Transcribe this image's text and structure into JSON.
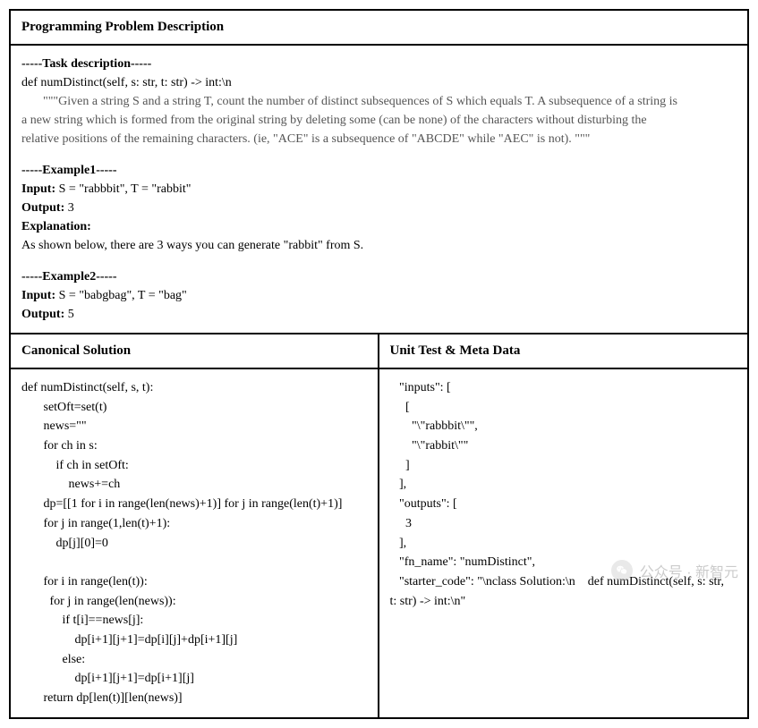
{
  "header": {
    "title": "Programming Problem Description"
  },
  "task": {
    "header": "-----Task description-----",
    "signature": "def numDistinct(self, s: str, t: str) -> int:\\n",
    "docstring": "\"\"\"Given a string S and a string T, count the number of distinct subsequences of S which equals T. A subsequence of a string is",
    "docstring2": "a new string which is formed from the original string by deleting some (can be none) of the characters without disturbing the",
    "docstring3": "relative positions of the remaining characters. (ie, \"ACE\" is a subsequence of \"ABCDE\" while \"AEC\" is not). \"\"\""
  },
  "example1": {
    "header": "-----Example1-----",
    "input_label": "Input:",
    "input_value": " S = \"rabbbit\", T = \"rabbit\"",
    "output_label": "Output:",
    "output_value": " 3",
    "explanation_label": "Explanation:",
    "explanation_text": "As shown below, there are 3 ways you can generate \"rabbit\" from S."
  },
  "example2": {
    "header": "-----Example2-----",
    "input_label": "Input:",
    "input_value": " S = \"babgbag\", T = \"bag\"",
    "output_label": "Output:",
    "output_value": " 5"
  },
  "columns": {
    "left_title": "Canonical Solution",
    "right_title": "Unit Test & Meta Data"
  },
  "solution": {
    "line1": "def numDistinct(self, s, t):",
    "line2": "       setOft=set(t)",
    "line3": "       news=\"\"",
    "line4": "       for ch in s:",
    "line5": "           if ch in setOft:",
    "line6": "               news+=ch",
    "line7": "       dp=[[1 for i in range(len(news)+1)] for j in range(len(t)+1)]",
    "line8": "       for j in range(1,len(t)+1):",
    "line9": "           dp[j][0]=0",
    "line10": "",
    "line11": "       for i in range(len(t)):",
    "line12": "         for j in range(len(news)):",
    "line13": "             if t[i]==news[j]:",
    "line14": "                 dp[i+1][j+1]=dp[i][j]+dp[i+1][j]",
    "line15": "             else:",
    "line16": "                 dp[i+1][j+1]=dp[i+1][j]",
    "line17": "       return dp[len(t)][len(news)]"
  },
  "unittest": {
    "line1": "   \"inputs\": [",
    "line2": "     [",
    "line3": "       \"\\\"rabbbit\\\"\",",
    "line4": "       \"\\\"rabbit\\\"\"",
    "line5": "     ]",
    "line6": "   ],",
    "line7": "   \"outputs\": [",
    "line8": "     3",
    "line9": "   ],",
    "line10": "   \"fn_name\": \"numDistinct\",",
    "line11": "   \"starter_code\": \"\\nclass Solution:\\n    def numDistinct(self, s: str,",
    "line12": "t: str) -> int:\\n\""
  },
  "watermark": {
    "text": "公众号 · 新智元"
  }
}
